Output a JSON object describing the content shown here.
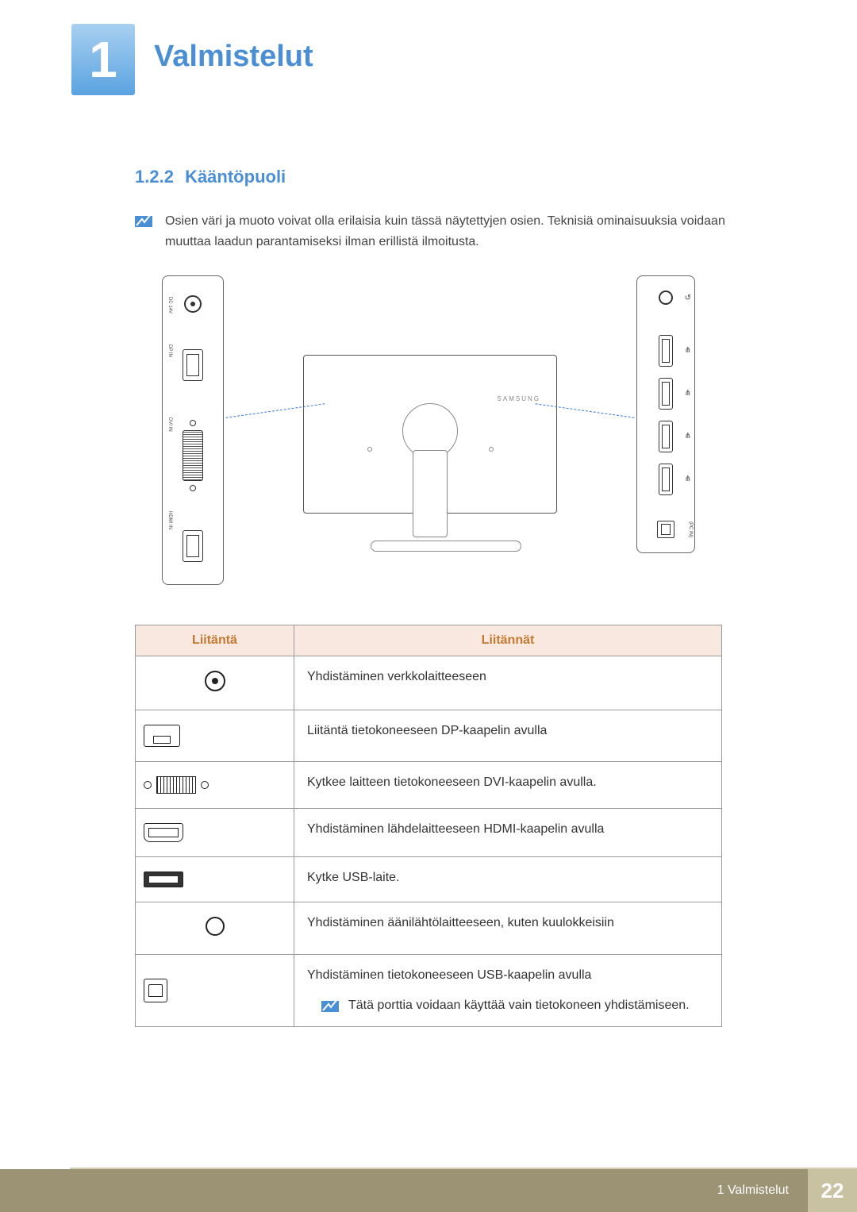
{
  "chapter": {
    "number": "1",
    "title": "Valmistelut"
  },
  "section": {
    "number": "1.2.2",
    "title": "Kääntöpuoli"
  },
  "intro_note": "Osien väri ja muoto voivat olla erilaisia kuin tässä näytettyjen osien. Teknisiä ominaisuuksia voidaan muuttaa laadun parantamiseksi ilman erillistä ilmoitusta.",
  "figure": {
    "left_ports": {
      "labels": {
        "dc": "DC 14V",
        "dp": "DP IN",
        "dvi": "DVI IN",
        "hdmi": "HDMI IN"
      }
    },
    "monitor_brand": "SAMSUNG",
    "right_ports": {
      "headphone_symbol": "♫",
      "usb_symbol": "⋔",
      "pc_in_label": "(PC IN)"
    }
  },
  "table": {
    "headers": {
      "col1": "Liitäntä",
      "col2": "Liitännät"
    },
    "rows": [
      {
        "icon": "dc",
        "desc": "Yhdistäminen verkkolaitteeseen"
      },
      {
        "icon": "dp",
        "desc": "Liitäntä tietokoneeseen DP-kaapelin avulla"
      },
      {
        "icon": "dvi",
        "desc": "Kytkee laitteen tietokoneeseen DVI-kaapelin avulla."
      },
      {
        "icon": "hdmi",
        "desc": "Yhdistäminen lähdelaitteeseen HDMI-kaapelin avulla"
      },
      {
        "icon": "usb",
        "desc": "Kytke USB-laite."
      },
      {
        "icon": "audio",
        "desc": "Yhdistäminen äänilähtölaitteeseen, kuten kuulokkeisiin"
      },
      {
        "icon": "usbpc",
        "desc": "Yhdistäminen tietokoneeseen USB-kaapelin avulla",
        "note": "Tätä porttia voidaan käyttää vain tietokoneen yhdistämiseen."
      }
    ]
  },
  "footer": {
    "crumb": "1 Valmistelut",
    "page": "22"
  }
}
